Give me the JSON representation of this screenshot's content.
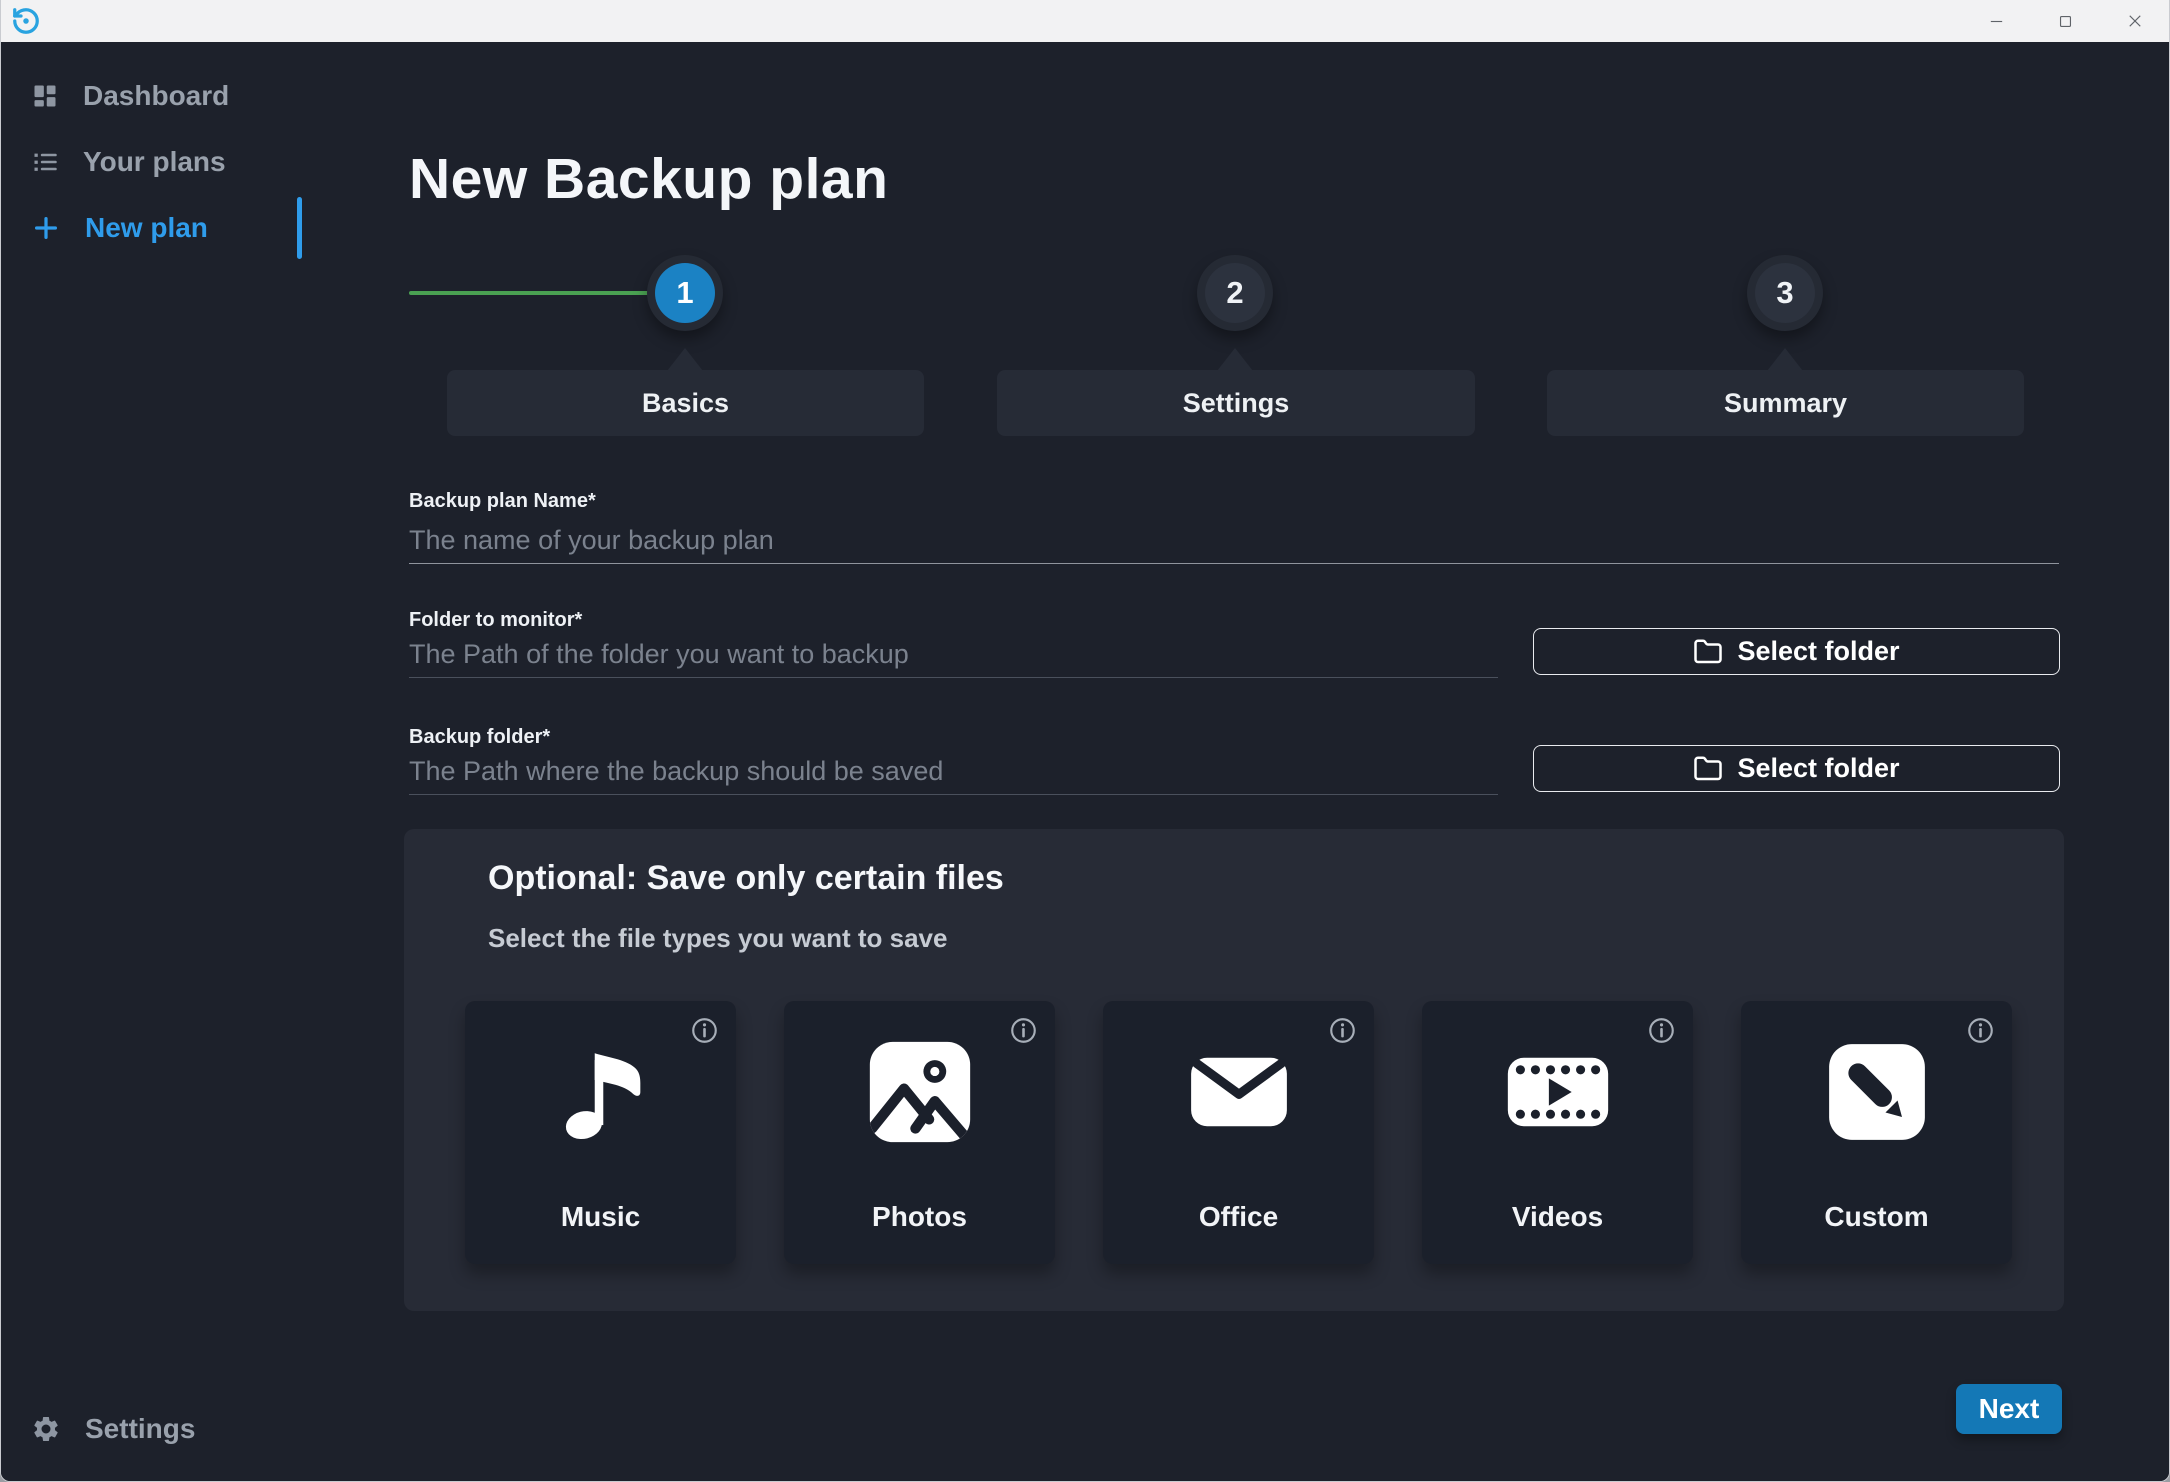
{
  "sidebar": {
    "items": [
      {
        "label": "Dashboard",
        "active": false
      },
      {
        "label": "Your plans",
        "active": false
      },
      {
        "label": "New plan",
        "active": true
      }
    ],
    "bottom_item": {
      "label": "Settings"
    }
  },
  "main": {
    "title": "New Backup plan",
    "steps": [
      {
        "number": "1",
        "label": "Basics",
        "state": "active"
      },
      {
        "number": "2",
        "label": "Settings",
        "state": "upcoming"
      },
      {
        "number": "3",
        "label": "Summary",
        "state": "upcoming"
      }
    ],
    "fields": [
      {
        "label": "Backup plan Name*",
        "placeholder": "The name of your backup plan",
        "value": ""
      },
      {
        "label": "Folder to monitor*",
        "placeholder": "The Path of the folder you want to backup",
        "value": "",
        "button_label": "Select folder"
      },
      {
        "label": "Backup folder*",
        "placeholder": "The Path where the backup should be saved",
        "value": "",
        "button_label": "Select folder"
      }
    ],
    "optional_section": {
      "title": "Optional: Save only certain files",
      "subtitle": "Select the file types you want to save",
      "cards": [
        {
          "label": "Music",
          "icon": "music-note-icon"
        },
        {
          "label": "Photos",
          "icon": "photo-icon"
        },
        {
          "label": "Office",
          "icon": "envelope-icon"
        },
        {
          "label": "Videos",
          "icon": "film-icon"
        },
        {
          "label": "Custom",
          "icon": "pencil-icon"
        }
      ]
    },
    "next_button": "Next"
  },
  "colors": {
    "accent_blue": "#2f9ceb",
    "step_active_blue": "#1b82c4",
    "next_button_blue": "#1478b6",
    "progress_green": "#4aa152",
    "background": "#1d212b",
    "panel": "#272b36",
    "card": "#1b202b",
    "titlebar": "#f2f2f3"
  }
}
